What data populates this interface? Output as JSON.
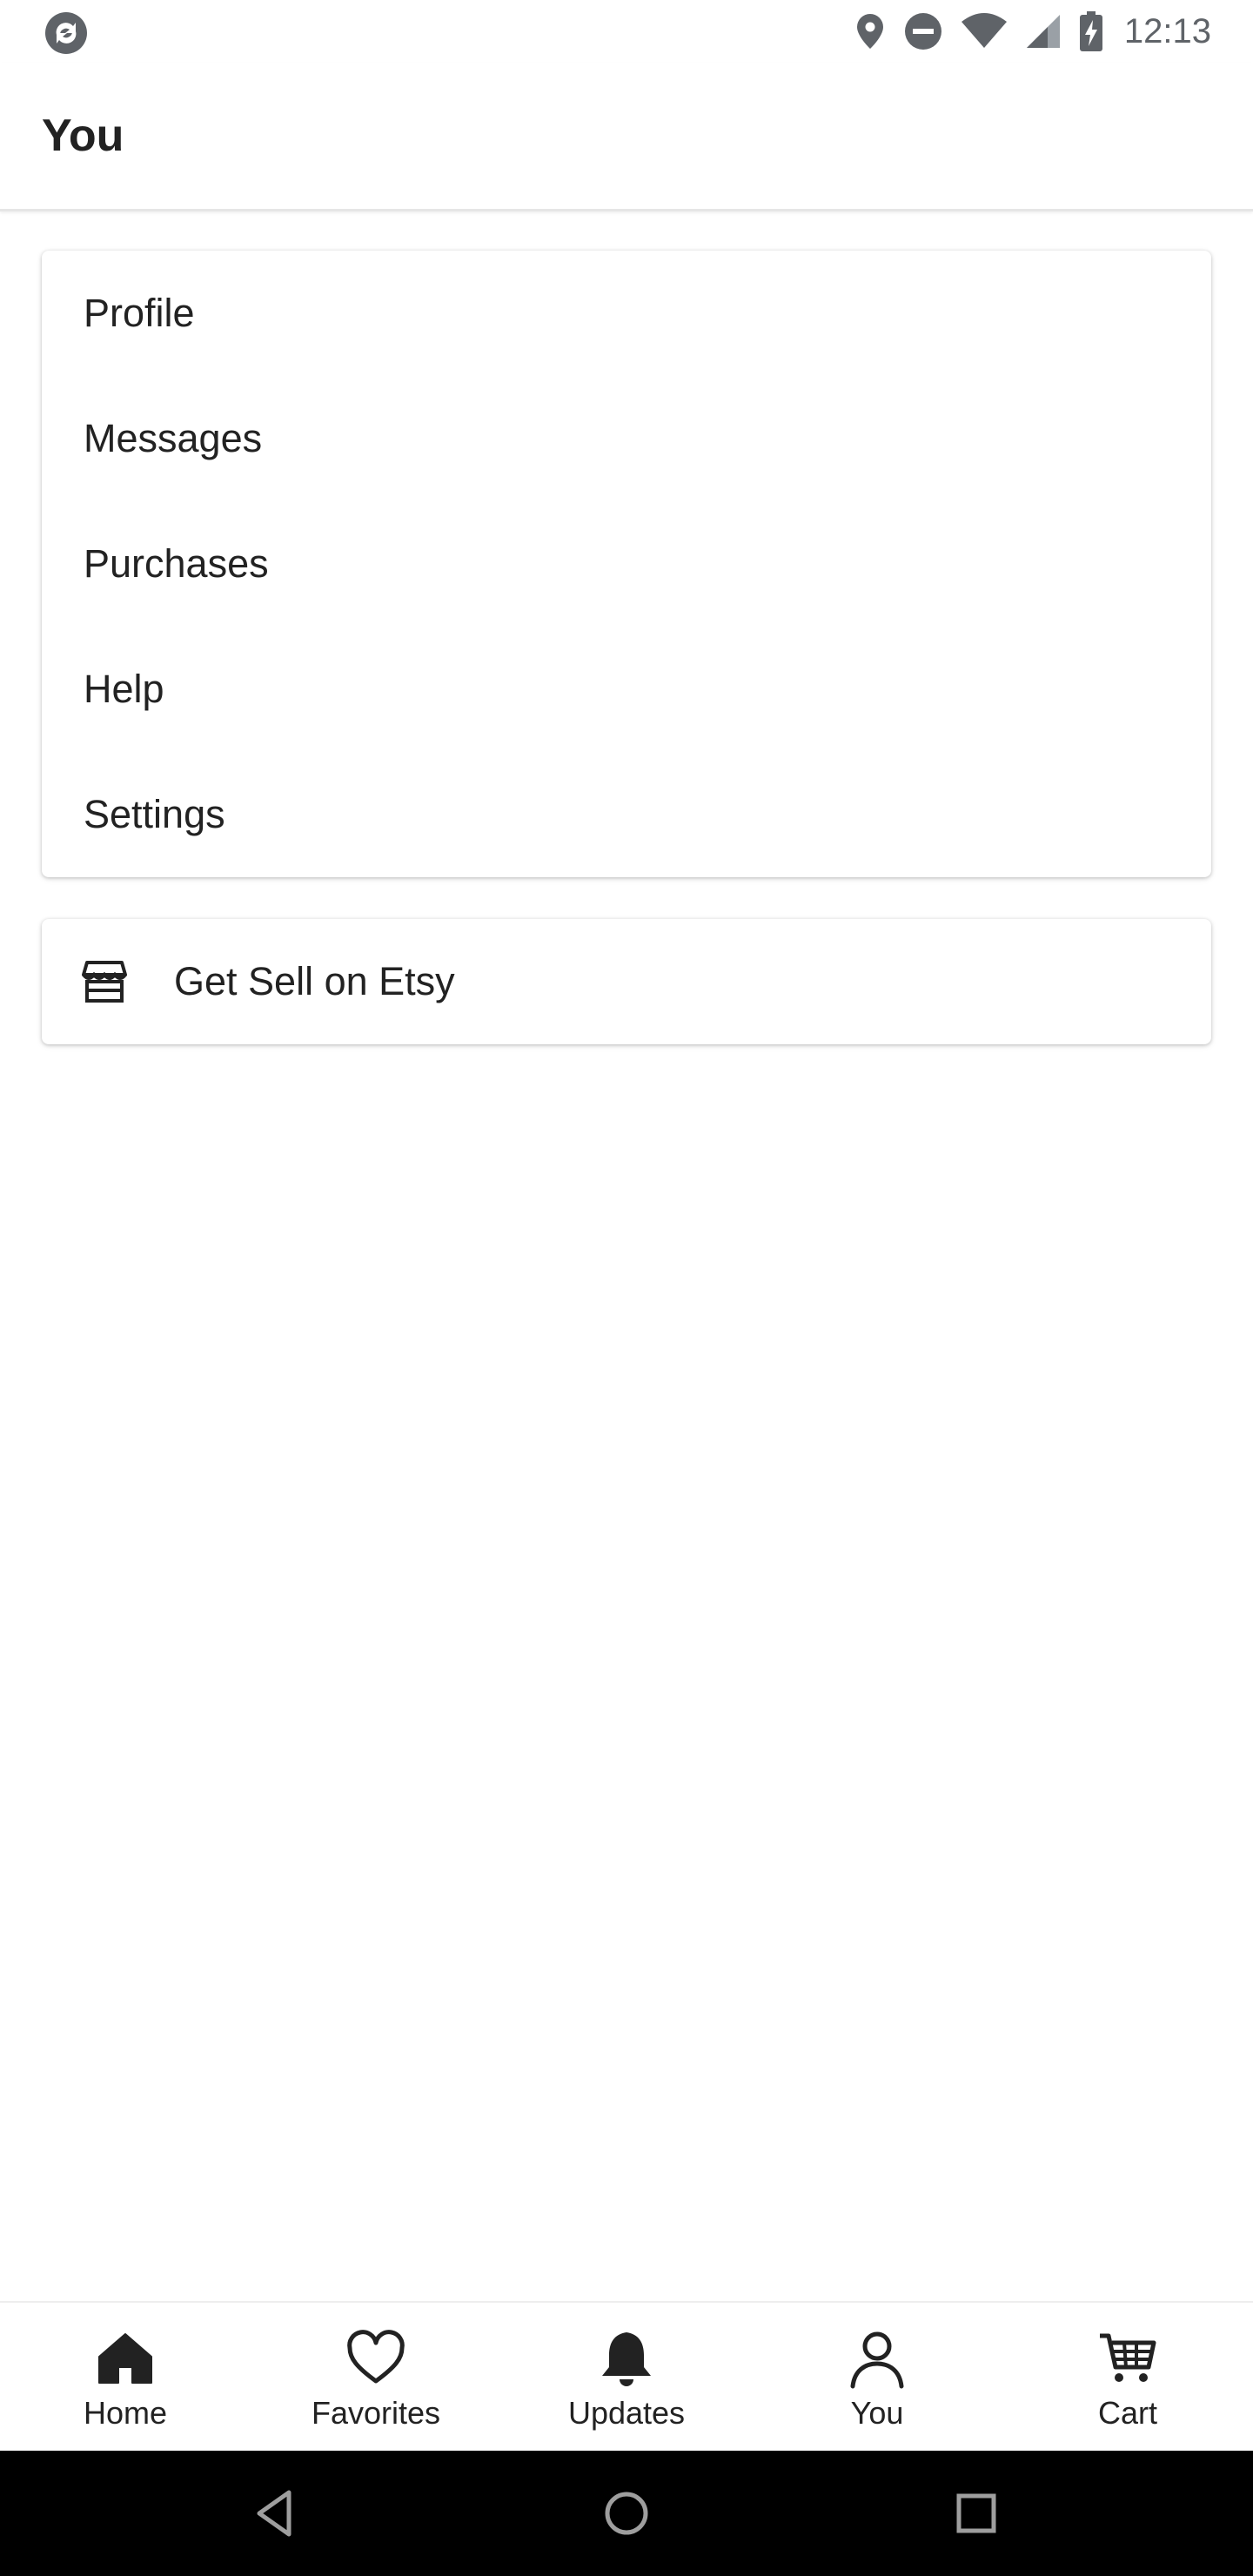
{
  "status_bar": {
    "time": "12:13",
    "icons": [
      "app-sync-icon",
      "location-icon",
      "do-not-disturb-icon",
      "wifi-icon",
      "cellular-signal-icon",
      "battery-charging-icon"
    ]
  },
  "header": {
    "title": "You"
  },
  "menu": {
    "items": [
      {
        "label": "Profile"
      },
      {
        "label": "Messages"
      },
      {
        "label": "Purchases"
      },
      {
        "label": "Help"
      },
      {
        "label": "Settings"
      }
    ]
  },
  "sell": {
    "label": "Get Sell on Etsy",
    "icon": "shop-icon"
  },
  "bottom_nav": {
    "items": [
      {
        "label": "Home",
        "icon": "home-icon"
      },
      {
        "label": "Favorites",
        "icon": "heart-icon"
      },
      {
        "label": "Updates",
        "icon": "bell-icon"
      },
      {
        "label": "You",
        "icon": "person-icon",
        "active": true
      },
      {
        "label": "Cart",
        "icon": "cart-icon"
      }
    ]
  },
  "system_nav": {
    "icons": [
      "back-icon",
      "home-circle-icon",
      "recents-icon"
    ]
  },
  "colors": {
    "text": "#222222",
    "status_icons": "#5f6368",
    "system_nav_bg": "#000000"
  }
}
